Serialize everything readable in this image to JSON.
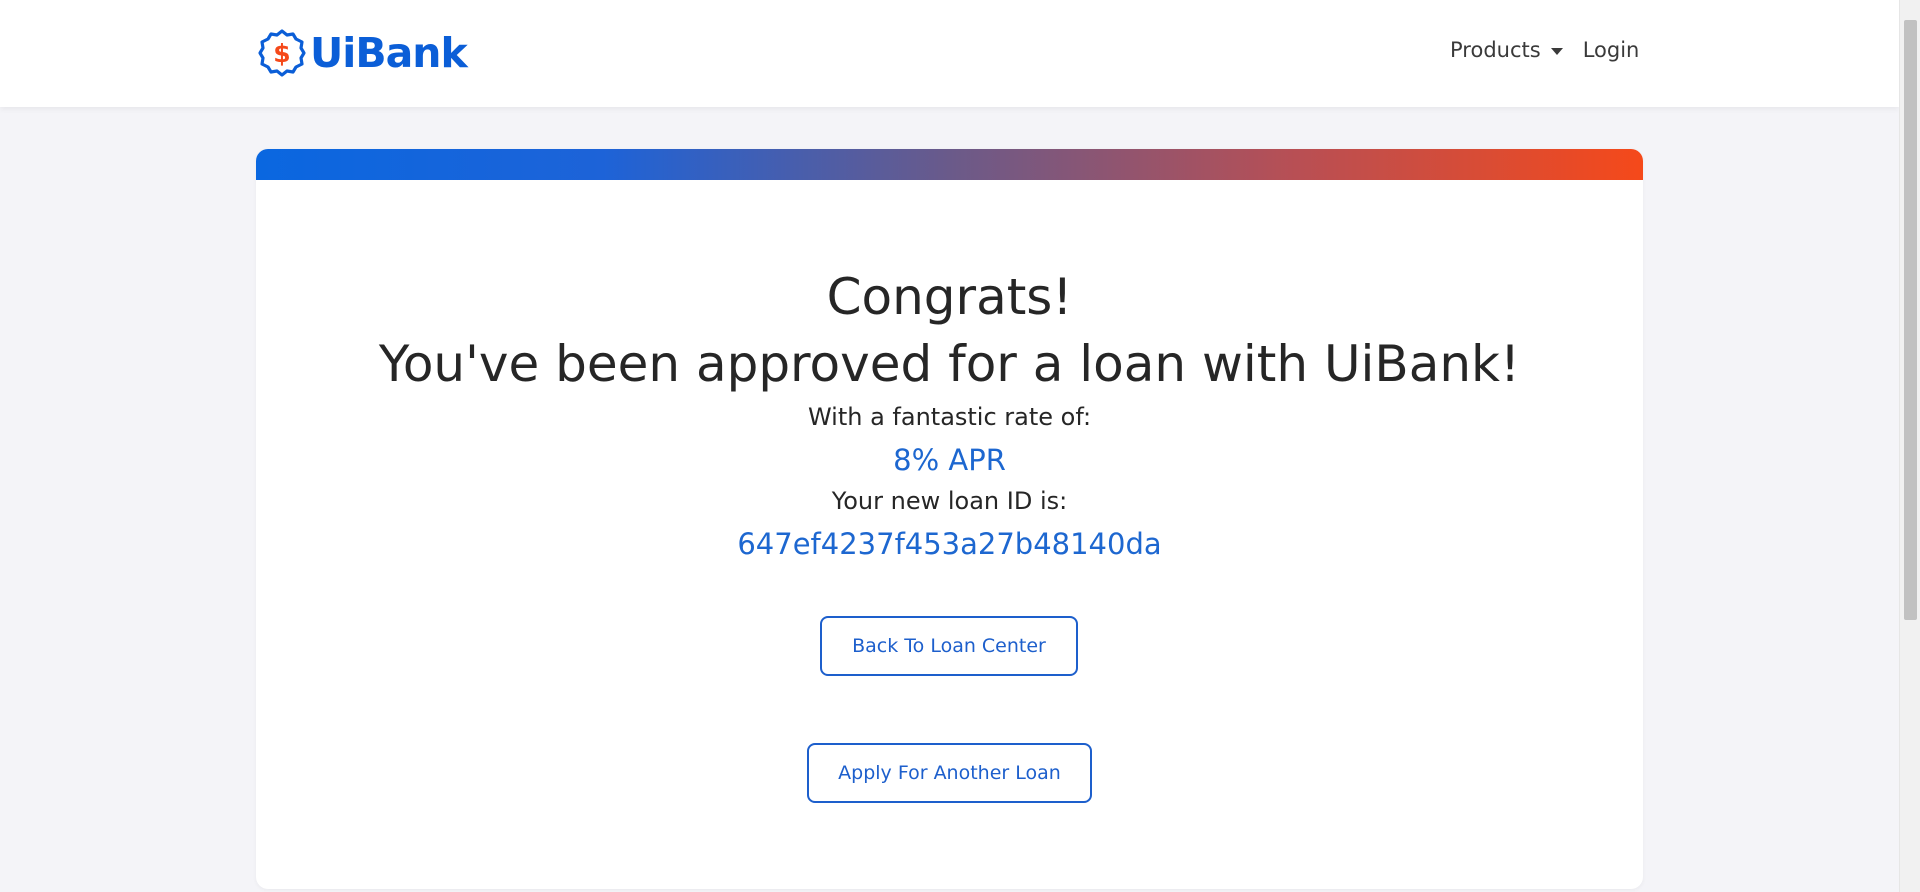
{
  "navbar": {
    "brand": "UiBank",
    "logo_symbol": "$",
    "products_label": "Products",
    "login_label": "Login"
  },
  "confirmation": {
    "title_line1": "Congrats!",
    "title_line2": "You've been approved for a loan with UiBank!",
    "rate_label": "With a fantastic rate of:",
    "rate_value": "8% APR",
    "loan_id_label": "Your new loan ID is:",
    "loan_id_value": "647ef4237f453a27b48140da"
  },
  "buttons": {
    "back_label": "Back To Loan Center",
    "apply_label": "Apply For Another Loan"
  },
  "colors": {
    "brand_blue": "#0b5ed7",
    "accent_orange": "#f5491a",
    "link_blue": "#1d67d0"
  },
  "icons": {
    "logo": "dollar-badge-icon",
    "products_caret": "caret-down-icon"
  }
}
